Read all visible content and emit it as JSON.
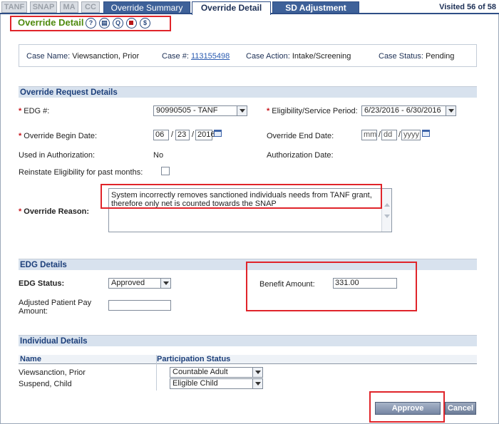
{
  "tabs": {
    "program_tabs": [
      "TANF",
      "SNAP",
      "MA",
      "CC"
    ],
    "main_tabs": [
      "Override Summary",
      "Override Detail",
      "SD Adjustment"
    ],
    "active_tab": "Override Detail",
    "visited": "Visited 56 of 58"
  },
  "page_title": "Override Detail",
  "title_icons": [
    "help-icon",
    "document-icon",
    "query-icon",
    "stop-icon",
    "dollar-icon"
  ],
  "title_icon_glyphs": [
    "?",
    "▤",
    "Q",
    "",
    "$"
  ],
  "case": {
    "name_label": "Case Name:",
    "name_value": "Viewsanction, Prior",
    "number_label": "Case #:",
    "number_value": "113155498",
    "action_label": "Case Action:",
    "action_value": "Intake/Screening",
    "status_label": "Case Status:",
    "status_value": "Pending"
  },
  "override_request": {
    "header": "Override Request Details",
    "edg_label": "EDG #:",
    "edg_value": "90990505 - TANF",
    "period_label": "Eligibility/Service Period:",
    "period_value": "6/23/2016 - 6/30/2016",
    "begin_label": "Override Begin Date:",
    "begin_mm": "06",
    "begin_dd": "23",
    "begin_yyyy": "2016",
    "end_label": "Override End Date:",
    "end_mm": "mm",
    "end_dd": "dd",
    "end_yyyy": "yyyy",
    "used_label": "Used in Authorization:",
    "used_value": "No",
    "auth_date_label": "Authorization Date:",
    "reinstate_label": "Reinstate Eligibility for past months:",
    "reason_label": "Override Reason:",
    "reason_value": "System incorrectly removes sanctioned individuals needs from TANF grant, therefore only net is counted towards the SNAP"
  },
  "edg_details": {
    "header": "EDG Details",
    "status_label": "EDG Status:",
    "status_value": "Approved",
    "benefit_label": "Benefit Amount:",
    "benefit_value": "331.00",
    "patient_pay_label": "Adjusted Patient Pay Amount:",
    "patient_pay_value": ""
  },
  "individuals": {
    "header": "Individual Details",
    "col_name": "Name",
    "col_status": "Participation Status",
    "rows": [
      {
        "name": "Viewsanction, Prior",
        "status": "Countable Adult"
      },
      {
        "name": "Suspend, Child",
        "status": "Eligible Child"
      }
    ]
  },
  "buttons": {
    "approve": "Approve",
    "cancel": "Cancel"
  },
  "colors": {
    "accent_blue": "#3e6199",
    "title_green": "#4f8a0e",
    "highlight_red": "#e0242a"
  }
}
